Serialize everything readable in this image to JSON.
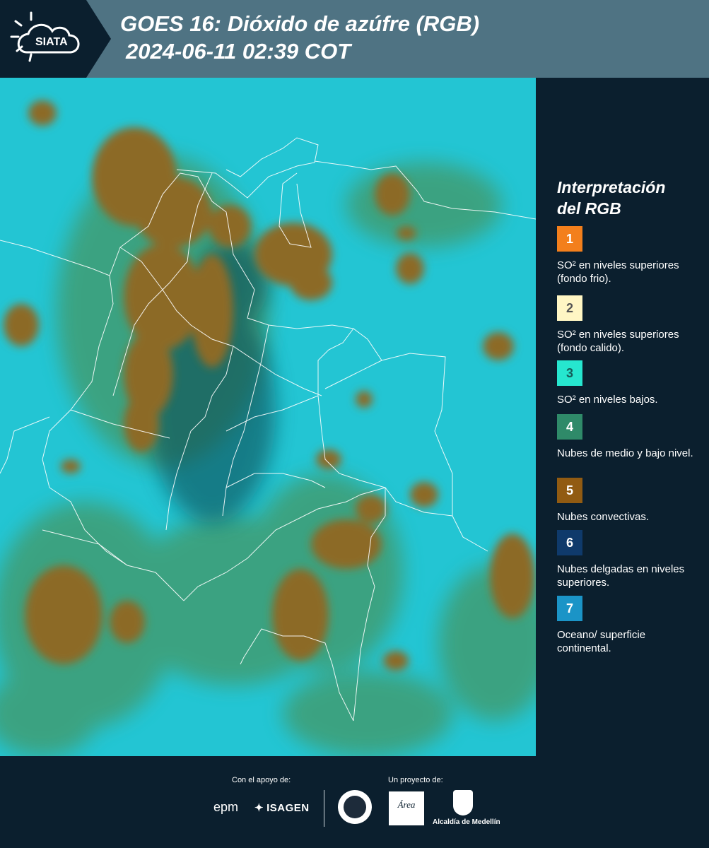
{
  "header": {
    "logo_text": "SIATA",
    "title_line1": "GOES 16: Dióxido de azúfre (RGB)",
    "title_line2": "2024-06-11 02:39 COT"
  },
  "legend": {
    "title_line1": "Interpretación",
    "title_line2": "del RGB",
    "items": [
      {
        "num": "1",
        "color": "#f37f1c",
        "text_color": "#ffffff",
        "label": "SO² en niveles superiores (fondo frio)."
      },
      {
        "num": "2",
        "color": "#fff6c4",
        "text_color": "#555555",
        "label": "SO² en niveles superiores (fondo calido)."
      },
      {
        "num": "3",
        "color": "#26e6cf",
        "text_color": "#155c58",
        "label": "SO² en niveles bajos."
      },
      {
        "num": "4",
        "color": "#2f8a69",
        "text_color": "#ffffff",
        "label": "Nubes de medio y bajo nivel."
      },
      {
        "num": "5",
        "color": "#915b12",
        "text_color": "#ffffff",
        "label": "Nubes convectivas."
      },
      {
        "num": "6",
        "color": "#0f3a6b",
        "text_color": "#ffffff",
        "label": "Nubes delgadas en niveles superiores."
      },
      {
        "num": "7",
        "color": "#1b94c7",
        "text_color": "#ffffff",
        "label": "Oceano/ superficie continental."
      }
    ]
  },
  "footer": {
    "support_label": "Con el apoyo de:",
    "project_label": "Un proyecto de:",
    "epm": "epm",
    "isagen": "ISAGEN",
    "area_logo": "Área",
    "alcaldia": "Alcaldía de Medellín"
  },
  "colors": {
    "header_bg": "#4f7383",
    "panel_bg": "#0b1f2e",
    "map_surface": "#22c4d2",
    "map_cloud_convective": "#8a6a26",
    "map_cloud_low": "#3c9a72"
  }
}
